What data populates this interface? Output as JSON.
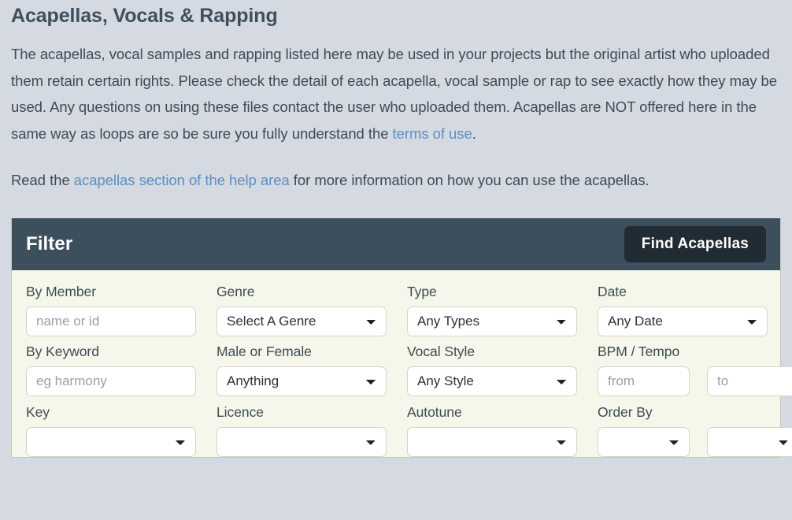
{
  "page": {
    "title": "Acapellas, Vocals & Rapping",
    "intro_paragraph_1": {
      "part_1": "The acapellas, vocal samples and rapping listed here may be used in your projects but the original artist who uploaded them retain certain rights. Please check the detail of each acapella, vocal sample or rap to see exactly how they may be used. Any questions on using these files contact the user who uploaded them. Acapellas are NOT offered here in the same way as loops are so be sure you fully understand the ",
      "link_text": "terms of use",
      "part_2": "."
    },
    "intro_paragraph_2": {
      "part_1": "Read the ",
      "link_text": "acapellas section of the help area",
      "part_2": " for more information on how you can use the acapellas."
    }
  },
  "filter": {
    "heading": "Filter",
    "submit_label": "Find Acapellas",
    "fields": {
      "by_member": {
        "label": "By Member",
        "placeholder": "name or id",
        "value": ""
      },
      "genre": {
        "label": "Genre",
        "value": "Select A Genre"
      },
      "type": {
        "label": "Type",
        "value": "Any Types"
      },
      "date": {
        "label": "Date",
        "value": "Any Date"
      },
      "by_keyword": {
        "label": "By Keyword",
        "placeholder": "eg harmony",
        "value": ""
      },
      "male_or_female": {
        "label": "Male or Female",
        "value": "Anything"
      },
      "vocal_style": {
        "label": "Vocal Style",
        "value": "Any Style"
      },
      "bpm_tempo": {
        "label": "BPM / Tempo",
        "from_placeholder": "from",
        "to_placeholder": "to",
        "from_value": "",
        "to_value": ""
      },
      "key": {
        "label": "Key",
        "value": ""
      },
      "licence": {
        "label": "Licence",
        "value": ""
      },
      "autotune": {
        "label": "Autotune",
        "value": ""
      },
      "order_by": {
        "label": "Order By",
        "value": ""
      }
    }
  },
  "colors": {
    "page_background": "#d4d9e2",
    "panel_background": "#f4f7e9",
    "header_background": "#3d4f5c",
    "button_background": "#202b33",
    "link": "#5a8fc6",
    "text": "#3f4b55"
  }
}
